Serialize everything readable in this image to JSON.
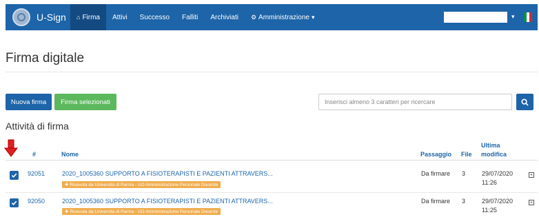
{
  "navbar": {
    "brand": "U-Sign",
    "items": [
      {
        "label": "Firma",
        "icon": "home-icon",
        "active": true
      },
      {
        "label": "Attivi"
      },
      {
        "label": "Successo"
      },
      {
        "label": "Falliti"
      },
      {
        "label": "Archiviati"
      },
      {
        "label": "Amministrazione",
        "icon": "settings-icon",
        "dropdown": true
      }
    ],
    "user_caret": "▾",
    "colors": {
      "navbar": "#1d64a8",
      "active": "#134a82"
    }
  },
  "page_title": "Firma digitale",
  "toolbar": {
    "new_label": "Nuova firma",
    "sign_selected_label": "Firma selezionati",
    "search_placeholder": "Inserisci almeno 3 caratteri per ricercare"
  },
  "section_title": "Attività di firma",
  "table": {
    "headers": {
      "id": "#",
      "name": "Nome",
      "step": "Passaggio",
      "files": "File",
      "modified_1": "Ultima",
      "modified_2": "modifica"
    },
    "rows": [
      {
        "checked": true,
        "id": "92051",
        "name": "2020_1005360 SUPPORTO A FISIOTERAPISTI E PAZIENTI ATTRAVERS...",
        "tag": "✚ Ricevuta da Università di Parma - UO Amministrazione Personale Docente",
        "step": "Da firmare",
        "files": "3",
        "date": "29/07/2020",
        "time": "11:26"
      },
      {
        "checked": true,
        "id": "92050",
        "name": "2020_1005360 SUPPORTO A FISIOTERAPISTI E PAZIENTI ATTRAVERS...",
        "tag": "✚ Ricevuta da Università di Parma - UO Amministrazione Personale Docente",
        "step": "Da firmare",
        "files": "3",
        "date": "29/07/2020",
        "time": "11:25"
      }
    ]
  }
}
